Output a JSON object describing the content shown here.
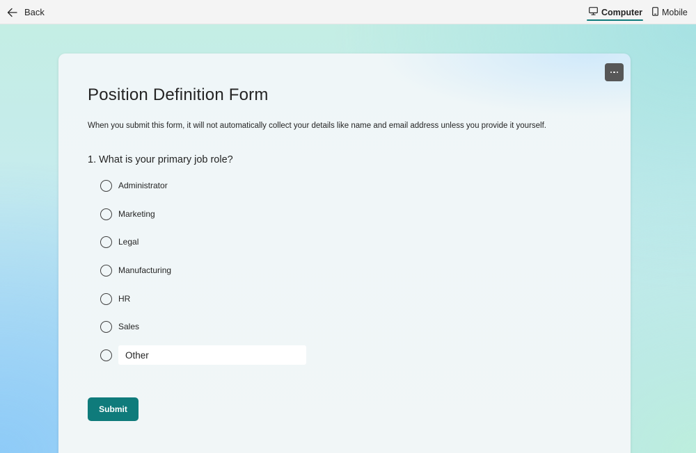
{
  "topbar": {
    "back_label": "Back",
    "views": [
      {
        "label": "Computer",
        "icon": "monitor-icon",
        "active": true
      },
      {
        "label": "Mobile",
        "icon": "phone-icon",
        "active": false
      }
    ]
  },
  "form": {
    "title": "Position Definition Form",
    "privacy_notice": "When you submit this form, it will not automatically collect your details like name and email address unless you provide it yourself.",
    "question": {
      "number": "1.",
      "text": "What is your primary job role?",
      "options": [
        "Administrator",
        "Marketing",
        "Legal",
        "Manufacturing",
        "HR",
        "Sales"
      ],
      "other_placeholder": "Other"
    },
    "submit_label": "Submit"
  },
  "colors": {
    "accent": "#0f7b7b",
    "more_button": "#575757"
  }
}
